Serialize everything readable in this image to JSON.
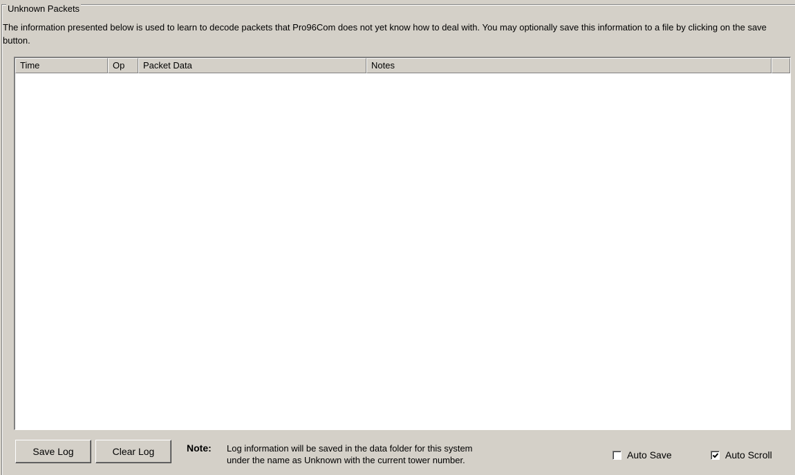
{
  "group": {
    "title": "Unknown Packets",
    "description": "The information presented below is used to learn to decode packets that Pro96Com does not yet know how to deal with.  You may optionally save this information to a file by clicking on the save button."
  },
  "list": {
    "columns": [
      "Time",
      "Op",
      "Packet Data",
      "Notes",
      ""
    ],
    "rows": []
  },
  "buttons": {
    "save_log": "Save Log",
    "clear_log": "Clear Log"
  },
  "note": {
    "label": "Note:",
    "line1": "Log information will be saved in the data folder for this system",
    "line2": "under the name as Unknown with the current tower number."
  },
  "options": {
    "auto_save": {
      "label": "Auto Save",
      "checked": false
    },
    "auto_scroll": {
      "label": "Auto Scroll",
      "checked": true
    }
  }
}
